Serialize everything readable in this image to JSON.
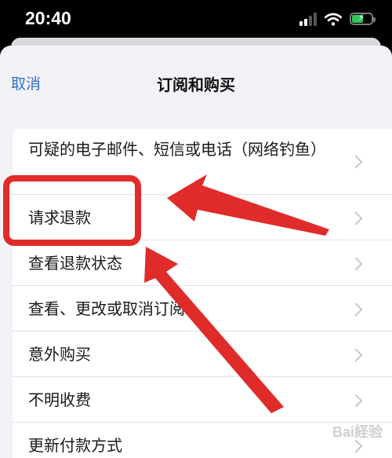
{
  "status_bar": {
    "time": "20:40"
  },
  "nav": {
    "cancel_label": "取消",
    "title": "订阅和购买"
  },
  "rows": [
    {
      "label": "可疑的电子邮件、短信或电话（网络钓鱼）"
    },
    {
      "label": "请求退款"
    },
    {
      "label": "查看退款状态"
    },
    {
      "label": "查看、更改或取消订阅"
    },
    {
      "label": "意外购买"
    },
    {
      "label": "不明收费"
    },
    {
      "label": "更新付款方式"
    }
  ],
  "annotation": {
    "box_color": "#e02b2b",
    "arrow_color": "#e02b2b"
  },
  "watermark": {
    "text": "Bai経验"
  },
  "colors": {
    "accent": "#2f73c9",
    "battery": "#34c759"
  }
}
